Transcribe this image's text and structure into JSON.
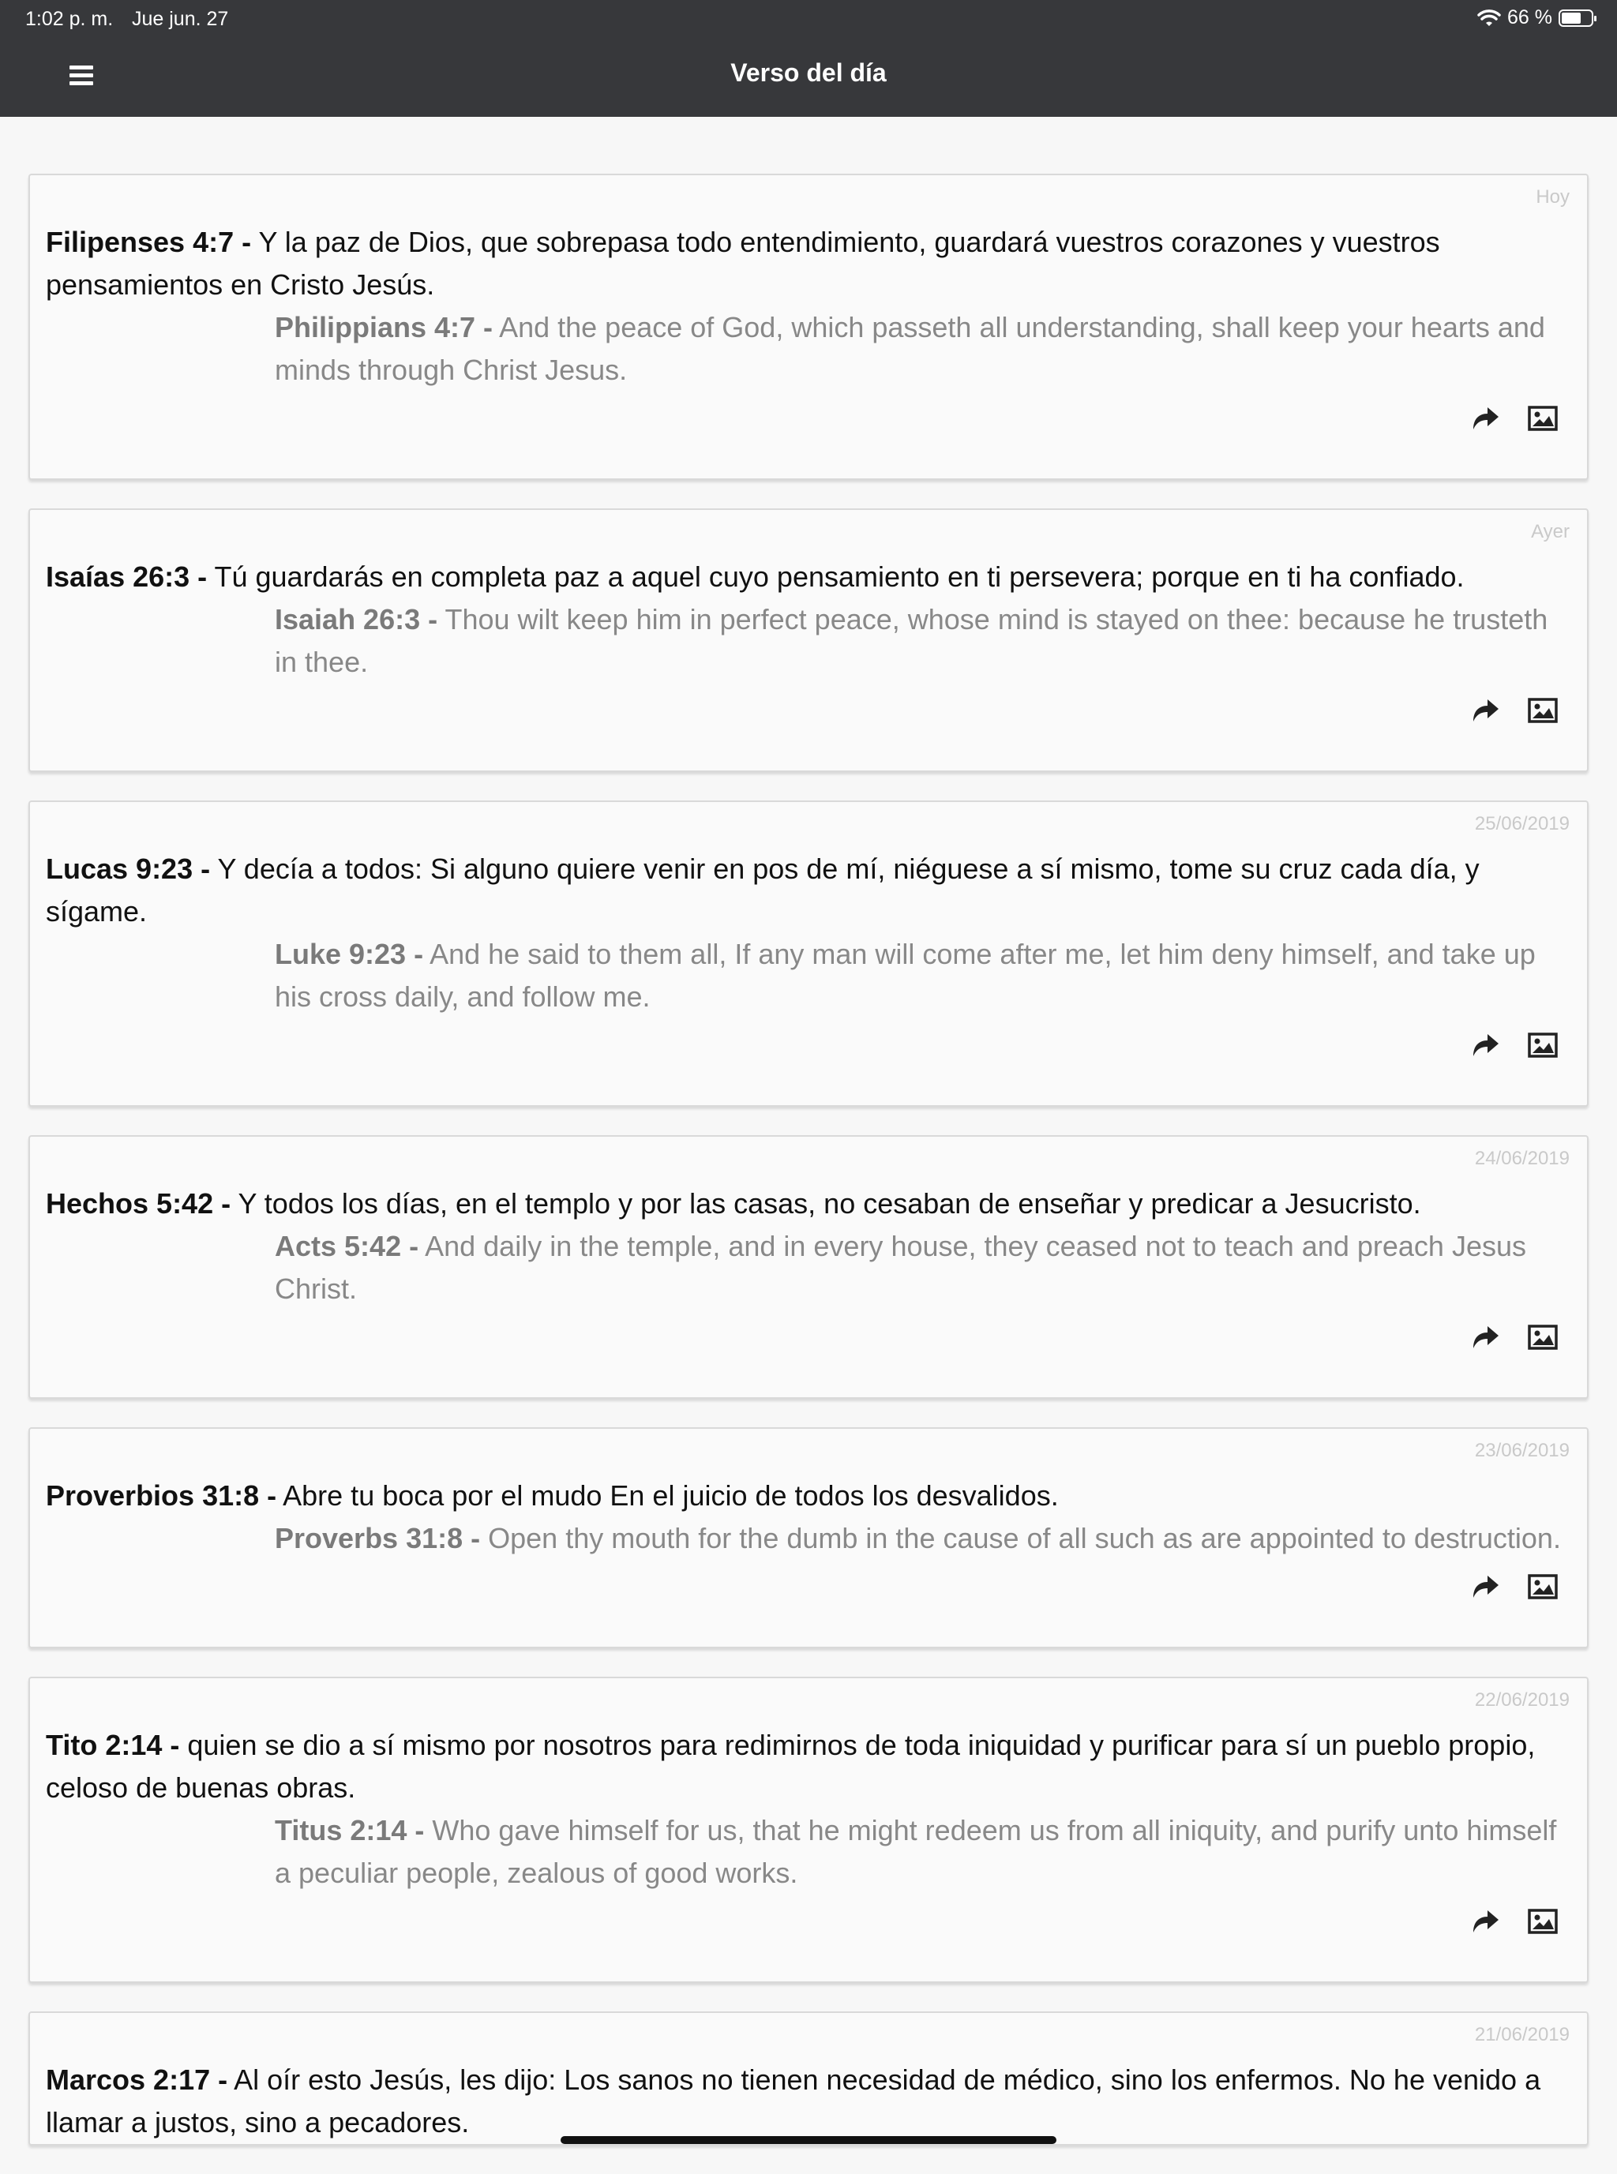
{
  "status": {
    "time": "1:02 p. m.",
    "date": "Jue jun. 27",
    "battery": "66 %",
    "battery_level": 0.66
  },
  "nav": {
    "title": "Verso del día"
  },
  "cards": [
    {
      "date": "Hoy",
      "ref_es": "Filipenses 4:7 -",
      "text_es": " Y la paz de Dios, que sobrepasa todo entendimiento, guardará vuestros corazones y vuestros pensamientos en Cristo Jesús.",
      "ref_en": "Philippians 4:7 -",
      "text_en": " And the peace of God, which passeth all understanding, shall keep your hearts and minds through Christ Jesus."
    },
    {
      "date": "Ayer",
      "ref_es": "Isaías 26:3 -",
      "text_es": " Tú guardarás en completa paz a aquel cuyo pensamiento en ti persevera; porque en ti ha confiado.",
      "ref_en": "Isaiah 26:3 -",
      "text_en": " Thou wilt keep him in perfect peace, whose mind is stayed on thee: because he trusteth in thee."
    },
    {
      "date": "25/06/2019",
      "ref_es": "Lucas 9:23 -",
      "text_es": " Y decía a todos: Si alguno quiere venir en pos de mí, niéguese a sí mismo, tome su cruz cada día, y sígame.",
      "ref_en": "Luke 9:23 -",
      "text_en": " And he said to them all, If any man will come after me, let him deny himself, and take up his cross daily, and follow me."
    },
    {
      "date": "24/06/2019",
      "ref_es": "Hechos 5:42 -",
      "text_es": " Y todos los días, en el templo y por las casas, no cesaban de enseñar y predicar a Jesucristo.",
      "ref_en": "Acts 5:42 -",
      "text_en": " And daily in the temple, and in every house, they ceased not to teach and preach Jesus Christ."
    },
    {
      "date": "23/06/2019",
      "ref_es": "Proverbios 31:8 -",
      "text_es": " Abre tu boca por el mudo En el juicio de todos los desvalidos.",
      "ref_en": "Proverbs 31:8 -",
      "text_en": " Open thy mouth for the dumb in the cause of all such as are appointed to destruction."
    },
    {
      "date": "22/06/2019",
      "ref_es": "Tito 2:14 -",
      "text_es": " quien se dio a sí mismo por nosotros para redimirnos de toda iniquidad y purificar para sí un pueblo propio, celoso de buenas obras.",
      "ref_en": "Titus 2:14 -",
      "text_en": " Who gave himself for us, that he might redeem us from all iniquity, and purify unto himself a peculiar people, zealous of good works."
    },
    {
      "date": "21/06/2019",
      "ref_es": "Marcos 2:17 -",
      "text_es": " Al oír esto Jesús, les dijo: Los sanos no tienen necesidad de médico, sino los enfermos. No he venido a llamar a justos, sino a pecadores.",
      "ref_en": "",
      "text_en": ""
    }
  ],
  "icons": {
    "share": "share-icon",
    "image": "image-icon"
  },
  "colors": {
    "bar": "#37383b",
    "background": "#f7f7f7",
    "card": "#fafafa",
    "english_text": "#888888",
    "date_text": "#c9c9c9"
  }
}
